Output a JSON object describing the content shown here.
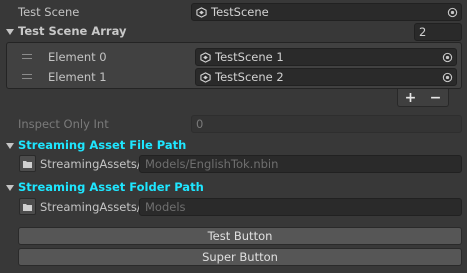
{
  "test_scene": {
    "label": "Test Scene",
    "value": "TestScene",
    "scene_icon": "unity-scene-icon",
    "picker_icon": "object-picker-icon"
  },
  "test_scene_array": {
    "label": "Test Scene Array",
    "size": "2",
    "elements": [
      {
        "label": "Element 0",
        "value": "TestScene 1"
      },
      {
        "label": "Element 1",
        "value": "TestScene 2"
      }
    ],
    "add_label": "+",
    "remove_label": "−"
  },
  "inspect_only_int": {
    "label": "Inspect Only Int",
    "value": "0"
  },
  "streaming_file": {
    "title": "Streaming Asset File Path",
    "prefix": "StreamingAssets/",
    "value": "Models/EnglishTok.nbin"
  },
  "streaming_folder": {
    "title": "Streaming Asset Folder Path",
    "prefix": "StreamingAssets/",
    "value": "Models"
  },
  "buttons": {
    "test_button": "Test Button",
    "super_button": "Super Button"
  },
  "colors": {
    "background": "#383838",
    "accent_title": "#1ee6ff"
  }
}
